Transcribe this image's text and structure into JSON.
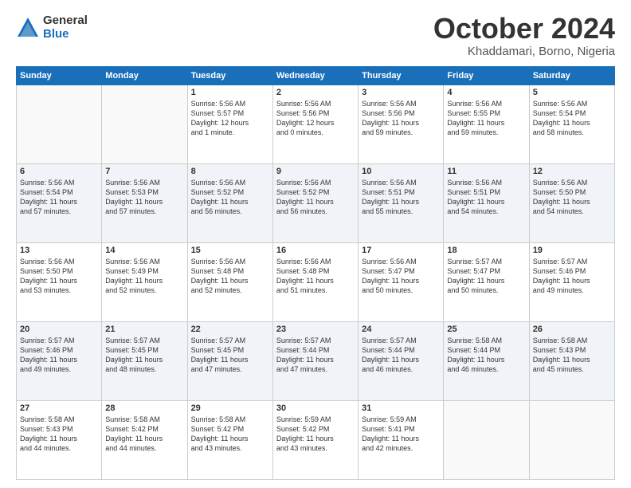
{
  "header": {
    "logo_general": "General",
    "logo_blue": "Blue",
    "month": "October 2024",
    "location": "Khaddamari, Borno, Nigeria"
  },
  "days_of_week": [
    "Sunday",
    "Monday",
    "Tuesday",
    "Wednesday",
    "Thursday",
    "Friday",
    "Saturday"
  ],
  "weeks": [
    [
      {
        "day": "",
        "info": ""
      },
      {
        "day": "",
        "info": ""
      },
      {
        "day": "1",
        "info": "Sunrise: 5:56 AM\nSunset: 5:57 PM\nDaylight: 12 hours\nand 1 minute."
      },
      {
        "day": "2",
        "info": "Sunrise: 5:56 AM\nSunset: 5:56 PM\nDaylight: 12 hours\nand 0 minutes."
      },
      {
        "day": "3",
        "info": "Sunrise: 5:56 AM\nSunset: 5:56 PM\nDaylight: 11 hours\nand 59 minutes."
      },
      {
        "day": "4",
        "info": "Sunrise: 5:56 AM\nSunset: 5:55 PM\nDaylight: 11 hours\nand 59 minutes."
      },
      {
        "day": "5",
        "info": "Sunrise: 5:56 AM\nSunset: 5:54 PM\nDaylight: 11 hours\nand 58 minutes."
      }
    ],
    [
      {
        "day": "6",
        "info": "Sunrise: 5:56 AM\nSunset: 5:54 PM\nDaylight: 11 hours\nand 57 minutes."
      },
      {
        "day": "7",
        "info": "Sunrise: 5:56 AM\nSunset: 5:53 PM\nDaylight: 11 hours\nand 57 minutes."
      },
      {
        "day": "8",
        "info": "Sunrise: 5:56 AM\nSunset: 5:52 PM\nDaylight: 11 hours\nand 56 minutes."
      },
      {
        "day": "9",
        "info": "Sunrise: 5:56 AM\nSunset: 5:52 PM\nDaylight: 11 hours\nand 56 minutes."
      },
      {
        "day": "10",
        "info": "Sunrise: 5:56 AM\nSunset: 5:51 PM\nDaylight: 11 hours\nand 55 minutes."
      },
      {
        "day": "11",
        "info": "Sunrise: 5:56 AM\nSunset: 5:51 PM\nDaylight: 11 hours\nand 54 minutes."
      },
      {
        "day": "12",
        "info": "Sunrise: 5:56 AM\nSunset: 5:50 PM\nDaylight: 11 hours\nand 54 minutes."
      }
    ],
    [
      {
        "day": "13",
        "info": "Sunrise: 5:56 AM\nSunset: 5:50 PM\nDaylight: 11 hours\nand 53 minutes."
      },
      {
        "day": "14",
        "info": "Sunrise: 5:56 AM\nSunset: 5:49 PM\nDaylight: 11 hours\nand 52 minutes."
      },
      {
        "day": "15",
        "info": "Sunrise: 5:56 AM\nSunset: 5:48 PM\nDaylight: 11 hours\nand 52 minutes."
      },
      {
        "day": "16",
        "info": "Sunrise: 5:56 AM\nSunset: 5:48 PM\nDaylight: 11 hours\nand 51 minutes."
      },
      {
        "day": "17",
        "info": "Sunrise: 5:56 AM\nSunset: 5:47 PM\nDaylight: 11 hours\nand 50 minutes."
      },
      {
        "day": "18",
        "info": "Sunrise: 5:57 AM\nSunset: 5:47 PM\nDaylight: 11 hours\nand 50 minutes."
      },
      {
        "day": "19",
        "info": "Sunrise: 5:57 AM\nSunset: 5:46 PM\nDaylight: 11 hours\nand 49 minutes."
      }
    ],
    [
      {
        "day": "20",
        "info": "Sunrise: 5:57 AM\nSunset: 5:46 PM\nDaylight: 11 hours\nand 49 minutes."
      },
      {
        "day": "21",
        "info": "Sunrise: 5:57 AM\nSunset: 5:45 PM\nDaylight: 11 hours\nand 48 minutes."
      },
      {
        "day": "22",
        "info": "Sunrise: 5:57 AM\nSunset: 5:45 PM\nDaylight: 11 hours\nand 47 minutes."
      },
      {
        "day": "23",
        "info": "Sunrise: 5:57 AM\nSunset: 5:44 PM\nDaylight: 11 hours\nand 47 minutes."
      },
      {
        "day": "24",
        "info": "Sunrise: 5:57 AM\nSunset: 5:44 PM\nDaylight: 11 hours\nand 46 minutes."
      },
      {
        "day": "25",
        "info": "Sunrise: 5:58 AM\nSunset: 5:44 PM\nDaylight: 11 hours\nand 46 minutes."
      },
      {
        "day": "26",
        "info": "Sunrise: 5:58 AM\nSunset: 5:43 PM\nDaylight: 11 hours\nand 45 minutes."
      }
    ],
    [
      {
        "day": "27",
        "info": "Sunrise: 5:58 AM\nSunset: 5:43 PM\nDaylight: 11 hours\nand 44 minutes."
      },
      {
        "day": "28",
        "info": "Sunrise: 5:58 AM\nSunset: 5:42 PM\nDaylight: 11 hours\nand 44 minutes."
      },
      {
        "day": "29",
        "info": "Sunrise: 5:58 AM\nSunset: 5:42 PM\nDaylight: 11 hours\nand 43 minutes."
      },
      {
        "day": "30",
        "info": "Sunrise: 5:59 AM\nSunset: 5:42 PM\nDaylight: 11 hours\nand 43 minutes."
      },
      {
        "day": "31",
        "info": "Sunrise: 5:59 AM\nSunset: 5:41 PM\nDaylight: 11 hours\nand 42 minutes."
      },
      {
        "day": "",
        "info": ""
      },
      {
        "day": "",
        "info": ""
      }
    ]
  ]
}
